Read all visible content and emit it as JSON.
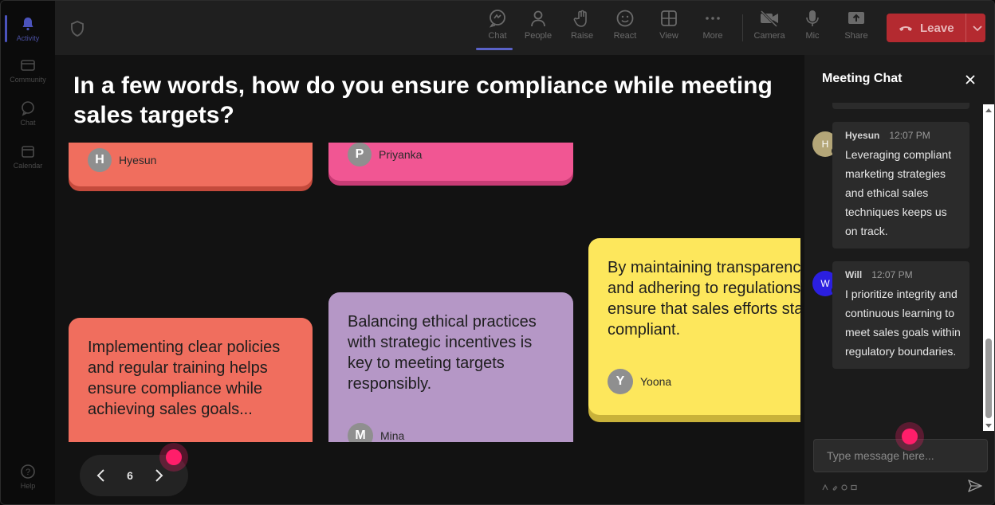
{
  "rail": {
    "items": [
      {
        "id": "activity",
        "label": "Activity",
        "icon": "bell-icon",
        "active": true
      },
      {
        "id": "community",
        "label": "Community",
        "icon": "community-icon"
      },
      {
        "id": "chat",
        "label": "Chat",
        "icon": "chat-icon"
      },
      {
        "id": "calendar",
        "label": "Calendar",
        "icon": "calendar-icon"
      }
    ],
    "help_label": "Help"
  },
  "toolbar": {
    "items": [
      {
        "id": "chat",
        "label": "Chat",
        "icon": "chat-bubble-icon",
        "active": true
      },
      {
        "id": "people",
        "label": "People",
        "icon": "people-icon"
      },
      {
        "id": "raise",
        "label": "Raise",
        "icon": "hand-icon"
      },
      {
        "id": "react",
        "label": "React",
        "icon": "smiley-icon"
      },
      {
        "id": "view",
        "label": "View",
        "icon": "grid-icon"
      },
      {
        "id": "more",
        "label": "More",
        "icon": "ellipsis-icon"
      },
      {
        "id": "camera",
        "label": "Camera",
        "icon": "camera-off-icon"
      },
      {
        "id": "mic",
        "label": "Mic",
        "icon": "mic-icon"
      },
      {
        "id": "share",
        "label": "Share",
        "icon": "share-icon"
      }
    ],
    "leave_label": "Leave"
  },
  "stage": {
    "question": "In a few words, how do you ensure compliance while meeting sales targets?",
    "cards": [
      {
        "id": "a",
        "text": "",
        "author": "Hyesun",
        "initial": "H"
      },
      {
        "id": "b",
        "text": "",
        "author": "Priyanka",
        "initial": "P"
      },
      {
        "id": "c",
        "text": "By maintaining transparency and adhering to regulations, I ensure that sales efforts stay compliant.",
        "author": "Yoona",
        "initial": "Y"
      },
      {
        "id": "d",
        "text": "Implementing clear policies and regular training helps ensure compliance while achieving sales goals...",
        "author": "",
        "initial": ""
      },
      {
        "id": "e",
        "text": "Balancing ethical practices with strategic incentives is key to meeting targets responsibly.",
        "author": "Mina",
        "initial": "M"
      }
    ],
    "page_number": "6"
  },
  "chat": {
    "title": "Meeting Chat",
    "messages": [
      {
        "author": "Hyesun",
        "time": "12:07 PM",
        "initial": "H",
        "avatar_color": "#b4a678",
        "text": "Leveraging compliant marketing strategies and ethical sales techniques keeps us on track."
      },
      {
        "author": "Will",
        "time": "12:07 PM",
        "initial": "W",
        "avatar_color": "#2b1fe0",
        "text": "I prioritize integrity and continuous learning to meet sales goals within regulatory boundaries."
      }
    ],
    "input_placeholder": "Type message here..."
  },
  "colors": {
    "accent": "#5a62c8",
    "leave": "#b42a30",
    "highlight": "#ff1e6a"
  }
}
